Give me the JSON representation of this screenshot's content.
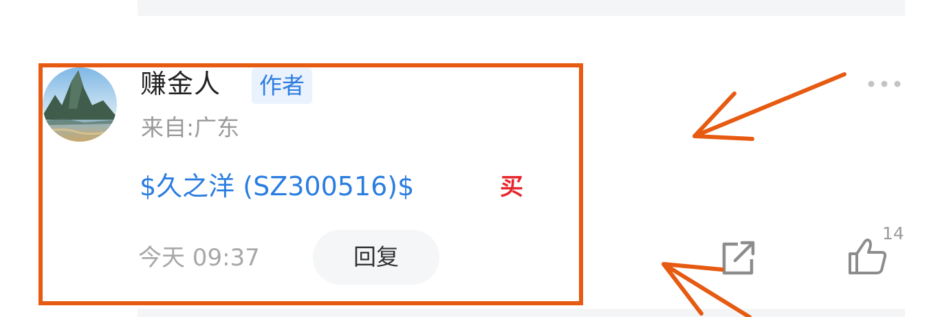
{
  "comment": {
    "username": "赚金人",
    "author_badge": "作者",
    "location": "来自:广东",
    "stock_link": "$久之洋 (SZ300516)$",
    "buy_badge": "买",
    "timestamp": "今天 09:37",
    "reply_label": "回复",
    "like_count": "14"
  },
  "icons": {
    "more": "more-dots-icon",
    "share": "share-icon",
    "like": "thumbs-up-icon"
  },
  "colors": {
    "link_blue": "#2a7de0",
    "badge_bg": "#e9f2fd",
    "buy_red": "#e6262b",
    "annotation_orange": "#e65a11",
    "muted_gray": "#9a9a9a"
  }
}
